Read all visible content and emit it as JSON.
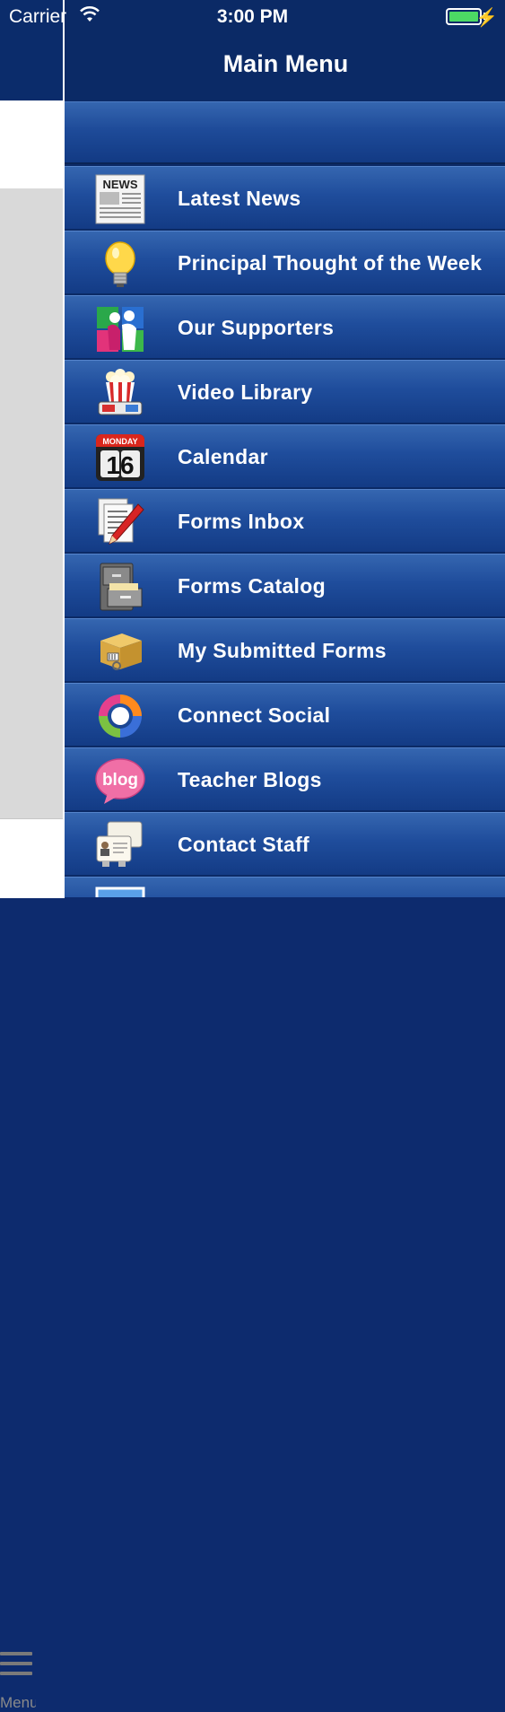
{
  "status_bar": {
    "carrier": "Carrier",
    "time": "3:00 PM"
  },
  "header": {
    "title": "Main Menu"
  },
  "background_app": {
    "tab_label": "Menu"
  },
  "menu": {
    "items": [
      {
        "label": "Latest News",
        "icon": "newspaper-icon"
      },
      {
        "label": "Principal Thought of the Week",
        "icon": "lightbulb-icon"
      },
      {
        "label": "Our Supporters",
        "icon": "supporters-icon"
      },
      {
        "label": "Video Library",
        "icon": "popcorn-icon"
      },
      {
        "label": "Calendar",
        "icon": "calendar-icon",
        "icon_text": {
          "month": "MONDAY",
          "day": "16"
        }
      },
      {
        "label": "Forms Inbox",
        "icon": "forms-pen-icon"
      },
      {
        "label": "Forms Catalog",
        "icon": "file-cabinet-icon"
      },
      {
        "label": "My Submitted Forms",
        "icon": "package-icon"
      },
      {
        "label": "Connect Social",
        "icon": "social-cycle-icon"
      },
      {
        "label": "Teacher Blogs",
        "icon": "blog-icon",
        "icon_text": "blog"
      },
      {
        "label": "Contact Staff",
        "icon": "contact-cards-icon"
      },
      {
        "label": "",
        "icon": "photo-icon"
      }
    ]
  },
  "colors": {
    "nav_bg": "#0b2a66",
    "row_top": "#3566b0",
    "row_bottom": "#133b85",
    "battery": "#4cd964"
  }
}
